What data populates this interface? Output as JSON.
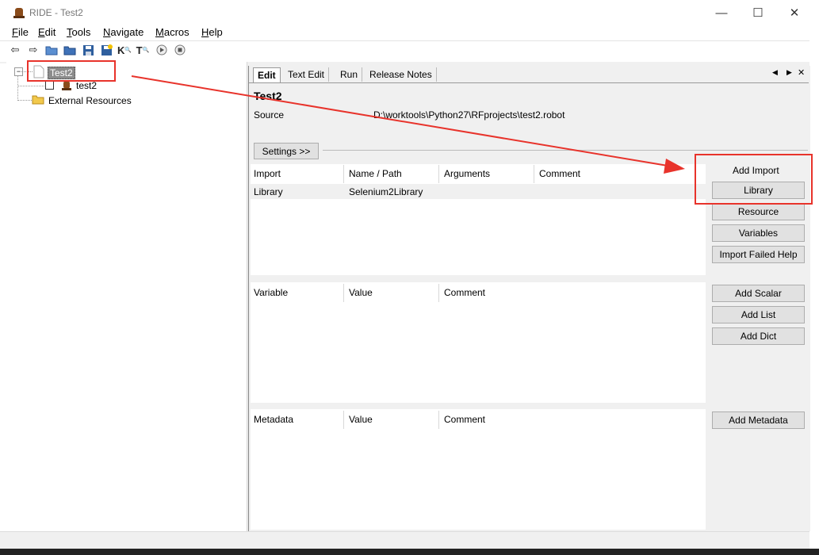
{
  "window": {
    "title": "RIDE - Test2",
    "minimize": "—",
    "maximize": "☐",
    "close": "✕"
  },
  "menu": [
    {
      "pre": "",
      "u": "F",
      "post": "ile"
    },
    {
      "pre": "",
      "u": "E",
      "post": "dit"
    },
    {
      "pre": "",
      "u": "T",
      "post": "ools"
    },
    {
      "pre": "",
      "u": "N",
      "post": "avigate"
    },
    {
      "pre": "",
      "u": "M",
      "post": "acros"
    },
    {
      "pre": "",
      "u": "H",
      "post": "elp"
    }
  ],
  "toolbar_icons": [
    "back-arrow",
    "forward-arrow",
    "open-folder",
    "open-directory",
    "save",
    "save-all",
    "search-keywords",
    "search-tests",
    "run",
    "stop"
  ],
  "tree": {
    "root": "Test2",
    "child": "test2",
    "external": "External Resources",
    "expander": "−"
  },
  "tabs": [
    "Edit",
    "Text Edit",
    "Run",
    "Release Notes"
  ],
  "tab_nav": {
    "left": "◀",
    "right": "▶",
    "close": "✕"
  },
  "suite": {
    "name": "Test2",
    "source_label": "Source",
    "source_path": "D:\\worktools\\Python27\\RFprojects\\test2.robot"
  },
  "settings_button": "Settings >>",
  "imports": {
    "headers": [
      "Import",
      "Name / Path",
      "Arguments",
      "Comment"
    ],
    "rows": [
      [
        "Library",
        "Selenium2Library",
        "",
        ""
      ]
    ]
  },
  "variables": {
    "headers": [
      "Variable",
      "Value",
      "Comment"
    ]
  },
  "metadata": {
    "headers": [
      "Metadata",
      "Value",
      "Comment"
    ]
  },
  "import_buttons": {
    "title": "Add Import",
    "library": "Library",
    "resource": "Resource",
    "variables": "Variables",
    "failed_help": "Import Failed Help"
  },
  "variable_buttons": {
    "scalar": "Add Scalar",
    "list": "Add List",
    "dict": "Add Dict"
  },
  "metadata_button": "Add Metadata",
  "colors": {
    "annotation": "#e8332b",
    "selection": "#8c8c8c"
  }
}
